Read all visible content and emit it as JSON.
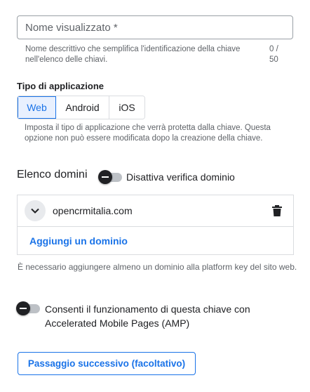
{
  "display_name": {
    "placeholder": "Nome visualizzato *",
    "value": "",
    "hint": "Nome descrittivo che semplifica l'identificazione della chiave nell'elenco delle chiavi.",
    "counter": "0 / 50"
  },
  "app_type": {
    "label": "Tipo di applicazione",
    "options": [
      "Web",
      "Android",
      "iOS"
    ],
    "selected": "Web",
    "hint": "Imposta il tipo di applicazione che verrà protetta dalla chiave. Questa opzione non può essere modificata dopo la creazione della chiave."
  },
  "domains": {
    "title": "Elenco domini",
    "toggle_label": "Disattiva verifica dominio",
    "toggle_on": false,
    "items": [
      {
        "name": "opencrmitalia.com"
      }
    ],
    "add_link": "Aggiungi un dominio",
    "hint": "È necessario aggiungere almeno un dominio alla platform key del sito web."
  },
  "amp": {
    "toggle_label": "Consenti il funzionamento di questa chiave con Accelerated Mobile Pages (AMP)",
    "toggle_on": false
  },
  "next_button": {
    "label": "Passaggio successivo (facoltativo)"
  },
  "icons": {
    "expand": "chevron-down-icon",
    "delete": "trash-icon"
  },
  "colors": {
    "accent": "#1a73e8",
    "selected_bg": "#e8f0fe",
    "text": "#202124",
    "secondary_text": "#5f6368",
    "border": "#dadce0"
  }
}
